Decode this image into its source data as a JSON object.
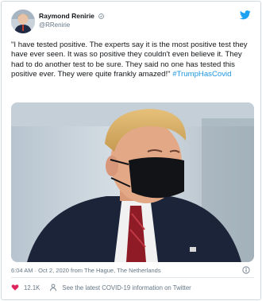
{
  "author": {
    "display_name": "Raymond Renirie",
    "handle": "@RRenirie",
    "avatar": "person-avatar",
    "verified_icon": "verified-badge-icon"
  },
  "brand": {
    "logo": "twitter-bird-icon",
    "color": "#1da1f2"
  },
  "tweet": {
    "text_main": "\"I have tested positive. The experts say it is the most positive test they have ever seen. It was so positive they couldn't even believe it. They had to do another test to be sure. They said no one has tested this positive ever. They were quite frankly amazed!\" ",
    "hashtag": "#TrumpHasCovid",
    "hashtag_color": "#1b95e0"
  },
  "media": {
    "description_icon": "photo-of-man-wearing-black-mask"
  },
  "meta": {
    "timestamp": "6:04 AM · Oct 2, 2020 from The Hague, The Netherlands",
    "info_icon": "info-icon"
  },
  "actions": {
    "like_icon": "heart-icon",
    "like_count": "12.1K",
    "covid_icon": "person-icon",
    "covid_link": "See the latest COVID-19 information on Twitter"
  },
  "colors": {
    "text": "#14171a",
    "secondary": "#657786",
    "like": "#e0245e"
  }
}
